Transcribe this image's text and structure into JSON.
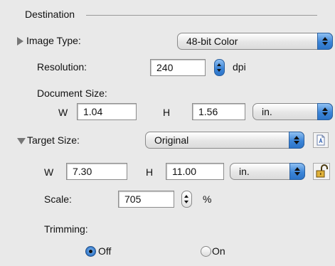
{
  "destination": {
    "title": "Destination"
  },
  "image_type": {
    "label": "Image Type:",
    "value": "48-bit Color"
  },
  "resolution": {
    "label": "Resolution:",
    "value": "240",
    "unit": "dpi"
  },
  "document_size": {
    "label": "Document Size:",
    "w_label": "W",
    "w_value": "1.04",
    "h_label": "H",
    "h_value": "1.56",
    "unit": "in."
  },
  "target_size": {
    "label": "Target Size:",
    "value": "Original",
    "w_label": "W",
    "w_value": "7.30",
    "h_label": "H",
    "h_value": "11.00",
    "unit": "in."
  },
  "scale": {
    "label": "Scale:",
    "value": "705",
    "unit": "%"
  },
  "trimming": {
    "label": "Trimming:",
    "off_label": "Off",
    "on_label": "On",
    "selected": "Off"
  },
  "colors": {
    "background": "#e9e9e9",
    "accent": "#3d86d8"
  },
  "icons": {
    "image_type_disclosure": "disclosure-triangle-right",
    "target_size_disclosure": "disclosure-triangle-down",
    "document": "document-icon",
    "lock": "padlock-icon"
  }
}
